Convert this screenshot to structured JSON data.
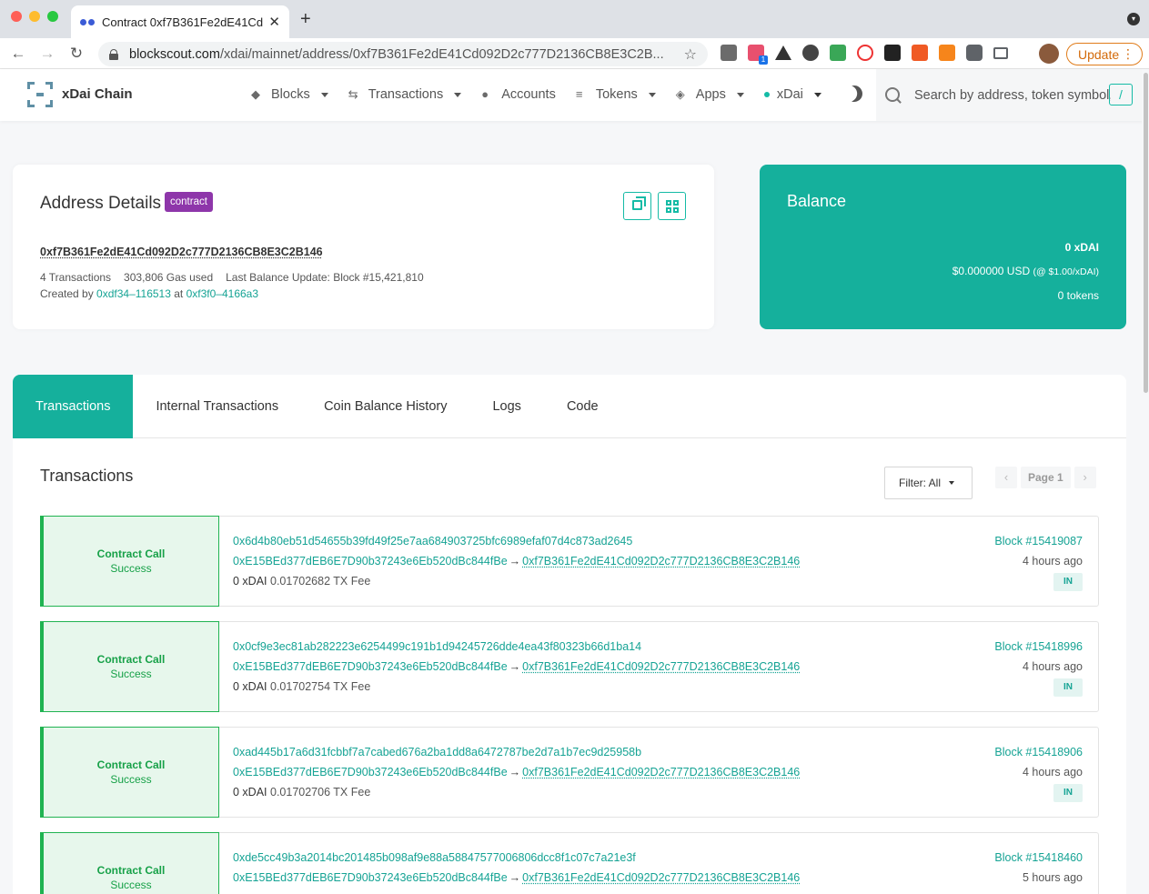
{
  "browser": {
    "tab_title": "Contract 0xf7B361Fe2dE41Cd0",
    "url_host": "blockscout.com",
    "url_path": "/xdai/mainnet/address/0xf7B361Fe2dE41Cd092D2c777D2136CB8E3C2B...",
    "update_label": "Update",
    "ext_badge": "1"
  },
  "header": {
    "brand": "xDai Chain",
    "menu": {
      "blocks": "Blocks",
      "transactions": "Transactions",
      "accounts": "Accounts",
      "tokens": "Tokens",
      "apps": "Apps",
      "network": "xDai"
    },
    "search_placeholder": "Search by address, token symbol, n",
    "search_key": "/"
  },
  "address": {
    "title": "Address Details",
    "badge": "contract",
    "hash": "0xf7B361Fe2dE41Cd092D2c777D2136CB8E3C2B146",
    "transactions": "4 Transactions",
    "gas_used": "303,806 Gas used",
    "last_balance": "Last Balance Update: Block #15,421,810",
    "created_by_label": "Created by",
    "creator": "0xdf34–116513",
    "at_label": "at",
    "creation_tx": "0xf3f0–4166a3"
  },
  "balance": {
    "title": "Balance",
    "amount": "0 xDAI",
    "usd": "$0.000000 USD",
    "usd_rate": "(@ $1.00/xDAI)",
    "tokens": "0 tokens"
  },
  "tabs": [
    "Transactions",
    "Internal Transactions",
    "Coin Balance History",
    "Logs",
    "Code"
  ],
  "section": {
    "title": "Transactions",
    "filter": "Filter: All",
    "page": "Page 1"
  },
  "transactions": [
    {
      "type": "Contract Call",
      "status": "Success",
      "hash": "0x6d4b80eb51d54655b39fd49f25e7aa684903725bfc6989efaf07d4c873ad2645",
      "from": "0xE15BEd377dEB6E7D90b37243e6Eb520dBc844fBe",
      "to": "0xf7B361Fe2dE41Cd092D2c777D2136CB8E3C2B146",
      "value": "0 xDAI",
      "fee": "0.01702682 TX Fee",
      "block": "Block #15419087",
      "age": "4 hours ago",
      "direction": "IN"
    },
    {
      "type": "Contract Call",
      "status": "Success",
      "hash": "0x0cf9e3ec81ab282223e6254499c191b1d94245726dde4ea43f80323b66d1ba14",
      "from": "0xE15BEd377dEB6E7D90b37243e6Eb520dBc844fBe",
      "to": "0xf7B361Fe2dE41Cd092D2c777D2136CB8E3C2B146",
      "value": "0 xDAI",
      "fee": "0.01702754 TX Fee",
      "block": "Block #15418996",
      "age": "4 hours ago",
      "direction": "IN"
    },
    {
      "type": "Contract Call",
      "status": "Success",
      "hash": "0xad445b17a6d31fcbbf7a7cabed676a2ba1dd8a6472787be2d7a1b7ec9d25958b",
      "from": "0xE15BEd377dEB6E7D90b37243e6Eb520dBc844fBe",
      "to": "0xf7B361Fe2dE41Cd092D2c777D2136CB8E3C2B146",
      "value": "0 xDAI",
      "fee": "0.01702706 TX Fee",
      "block": "Block #15418906",
      "age": "4 hours ago",
      "direction": "IN"
    },
    {
      "type": "Contract Call",
      "status": "Success",
      "hash": "0xde5cc49b3a2014bc201485b098af9e88a58847577006806dcc8f1c07c7a21e3f",
      "from": "0xE15BEd377dEB6E7D90b37243e6Eb520dBc844fBe",
      "to": "0xf7B361Fe2dE41Cd092D2c777D2136CB8E3C2B146",
      "value": "",
      "fee": "",
      "block": "Block #15418460",
      "age": "5 hours ago",
      "direction": ""
    }
  ],
  "colors": {
    "accent": "#15b09c",
    "contract_badge": "#8e36aa",
    "success": "#20b351"
  }
}
